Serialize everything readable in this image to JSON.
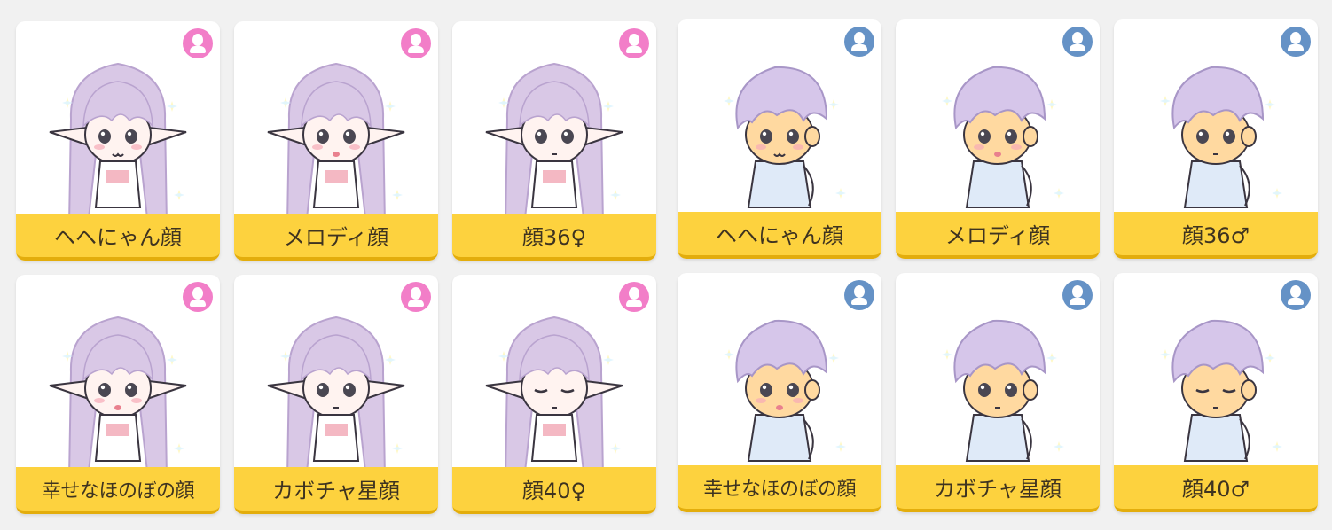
{
  "colors": {
    "female_badge": "#f27ec8",
    "male_badge": "#6592c6",
    "label_bg": "#fdd23e",
    "label_border": "#e3ad0c",
    "card_bg": "#ffffff",
    "page_bg": "#f1f1f1"
  },
  "cards": [
    {
      "name": "ヘヘにゃん顔",
      "gender": "female",
      "gender_icon": "female-user-icon",
      "expression": "cat-smile"
    },
    {
      "name": "メロディ顔",
      "gender": "female",
      "gender_icon": "female-user-icon",
      "expression": "melody"
    },
    {
      "name": "顔36♀",
      "gender": "female",
      "gender_icon": "female-user-icon",
      "expression": "neutral"
    },
    {
      "name": "ヘヘにゃん顔",
      "gender": "male",
      "gender_icon": "male-user-icon",
      "expression": "cat-smile"
    },
    {
      "name": "メロディ顔",
      "gender": "male",
      "gender_icon": "male-user-icon",
      "expression": "melody"
    },
    {
      "name": "顔36♂",
      "gender": "male",
      "gender_icon": "male-user-icon",
      "expression": "neutral"
    },
    {
      "name": "幸せなほのぼの顔",
      "gender": "female",
      "gender_icon": "female-user-icon",
      "expression": "happy"
    },
    {
      "name": "カボチャ星顔",
      "gender": "female",
      "gender_icon": "female-user-icon",
      "expression": "pumpkin-star"
    },
    {
      "name": "顔40♀",
      "gender": "female",
      "gender_icon": "female-user-icon",
      "expression": "sleepy"
    },
    {
      "name": "幸せなほのぼの顔",
      "gender": "male",
      "gender_icon": "male-user-icon",
      "expression": "happy"
    },
    {
      "name": "カボチャ星顔",
      "gender": "male",
      "gender_icon": "male-user-icon",
      "expression": "pumpkin-star"
    },
    {
      "name": "顔40♂",
      "gender": "male",
      "gender_icon": "male-user-icon",
      "expression": "sleepy"
    }
  ]
}
